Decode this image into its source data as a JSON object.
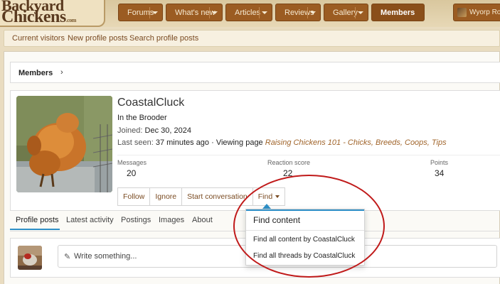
{
  "logo": {
    "line1": "Backyard",
    "line2": "Chickens",
    "suffix": ".com"
  },
  "nav": [
    {
      "label": "Forums"
    },
    {
      "label": "What's new"
    },
    {
      "label": "Articles"
    },
    {
      "label": "Reviews"
    },
    {
      "label": "Gallery"
    },
    {
      "label": "Members"
    }
  ],
  "user_menu": {
    "label": "Wyorp Roc"
  },
  "subnav": {
    "current_visitors": "Current visitors",
    "new_profile_posts": "New profile posts",
    "search_profile_posts": "Search profile posts"
  },
  "breadcrumb": {
    "label": "Members",
    "chevron": "›"
  },
  "profile": {
    "name": "CoastalCluck",
    "title": "In the Brooder",
    "joined_label": "Joined:",
    "joined_value": "Dec 30, 2024",
    "last_seen_label": "Last seen:",
    "last_seen_value": "37 minutes ago",
    "viewing_text": "· Viewing page",
    "viewing_link": "Raising Chickens 101 - Chicks, Breeds, Coops, Tips"
  },
  "stats": [
    {
      "label": "Messages",
      "value": "20"
    },
    {
      "label": "Reaction score",
      "value": "22"
    },
    {
      "label": "Points",
      "value": "34"
    }
  ],
  "buttons": {
    "follow": "Follow",
    "ignore": "Ignore",
    "start_conversation": "Start conversation",
    "find": "Find"
  },
  "tabs": [
    {
      "label": "Profile posts"
    },
    {
      "label": "Latest activity"
    },
    {
      "label": "Postings"
    },
    {
      "label": "Images"
    },
    {
      "label": "About"
    }
  ],
  "write": {
    "placeholder": "Write something..."
  },
  "find_menu": {
    "header": "Find content",
    "items": [
      "Find all content by CoastalCluck",
      "Find all threads by CoastalCluck"
    ]
  },
  "colors": {
    "nav_tab": "#9b5c22",
    "link": "#7a4b22",
    "accent": "#2d8fc7",
    "annotation": "#c01a1a"
  }
}
